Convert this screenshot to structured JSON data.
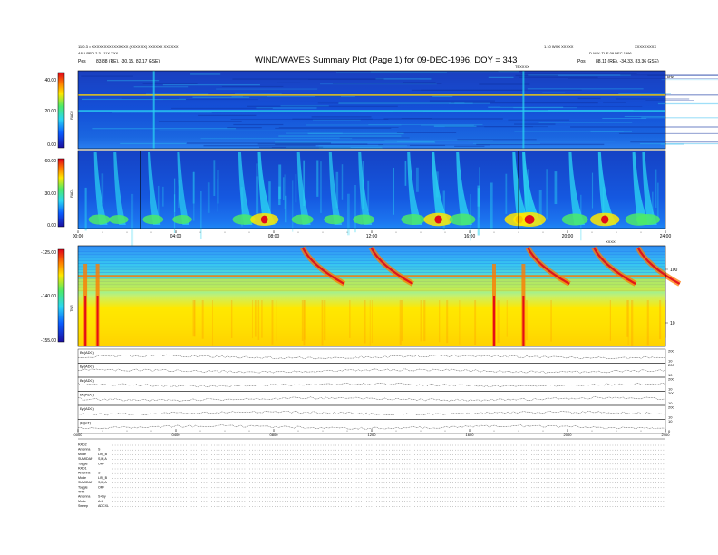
{
  "header": {
    "left_line1": "11 0.3 = XXXXXXXXXXXXXXX (XXXX XX) XXXXXX XXXXXX",
    "left_line2": "ASU PRO 2.3 - 11X XXX",
    "left_pos_label": "Pos",
    "left_pos_value": "83.88 (RE), -30.15, 82.17 GSE)",
    "title": "WIND/WAVES Summary Plot (Page 1) for 09-DEC-1996, DOY = 343",
    "right_line1_a": "1.10 WXX XXXXX",
    "right_line1_b": "XXXXXXXXX",
    "right_line2": "D-M-Y: TUE 09 DEC 1996",
    "right_pos_label": "Pos",
    "right_pos_value": "88.11 (RE), -34.33, 83.36 GSE)",
    "right_sub": "TEXXXX",
    "khz_label": "kHz"
  },
  "panels": {
    "rad2": {
      "label": "RAD2",
      "ticks": [
        "40.00",
        "20.00",
        "0.00"
      ]
    },
    "rad1": {
      "label": "RAD1",
      "ticks": [
        "60.00",
        "30.00",
        "0.00"
      ]
    },
    "tnr": {
      "label": "TNR",
      "ticks": [
        "-125.00",
        "-140.00",
        "-155.00"
      ],
      "right_ticks": [
        "100",
        "10"
      ]
    }
  },
  "time_axis": {
    "ticks": [
      "00:00",
      "04:00",
      "08:00",
      "12:00",
      "16:00",
      "20:00",
      "24:00"
    ],
    "ticks_small": [
      "0000",
      "0400",
      "0800",
      "1200",
      "1600",
      "2000",
      "2400"
    ],
    "right_label": "XXXX"
  },
  "traces": [
    {
      "label": "Bx(ADC)",
      "scale_top": "200",
      "scale_bot": "10"
    },
    {
      "label": "By(ADC)",
      "scale_top": "200",
      "scale_bot": "10"
    },
    {
      "label": "Bz(ADC)",
      "scale_top": "200",
      "scale_bot": "10"
    },
    {
      "label": "Ex(ADC)",
      "scale_top": "200",
      "scale_bot": "10"
    },
    {
      "label": "Ey(ADC)",
      "scale_top": "200",
      "scale_bot": "10"
    },
    {
      "label": "|B|(nT)",
      "scale_top": "10",
      "scale_bot": "0"
    }
  ],
  "status_rows": [
    "RAD2",
    "Antenna",
    "Mode",
    "SUMIDAP",
    "Toggle",
    "RAD1",
    "Antenna",
    "Mode",
    "SUMIDAP",
    "Toggle",
    "TNR",
    "Antenna",
    "Mode",
    "Sweep"
  ],
  "status_values": [
    "",
    "S",
    "LIN_B",
    "S,M,A",
    "OFF",
    "",
    "S",
    "LIN_B",
    "S,M,A",
    "OFF",
    "",
    "S+Sy",
    "A-B",
    "ADCXL"
  ],
  "colors": {
    "low": "#0a1f8f",
    "mid": "#2ad6f2",
    "high": "#ffe800",
    "peak": "#e0001a"
  },
  "chart_data": [
    {
      "type": "heatmap",
      "name": "RAD2",
      "x_range": [
        "00:00",
        "24:00"
      ],
      "ylim": [
        0,
        40
      ],
      "colorbar": {
        "min": 0.0,
        "mid": 20.0,
        "max": 40.0
      },
      "features": [
        {
          "kind": "narrowband-line",
          "y": 27.5,
          "x_start": 0,
          "x_end": 24
        },
        {
          "kind": "narrowband-line",
          "y": 19.5,
          "x_start": 0,
          "x_end": 24
        },
        {
          "kind": "burst",
          "x": 3.1
        },
        {
          "kind": "burst",
          "x": 18.2
        }
      ]
    },
    {
      "type": "heatmap",
      "name": "RAD1",
      "x_range": [
        "00:00",
        "24:00"
      ],
      "ylim": [
        0,
        60
      ],
      "colorbar": {
        "min": 0.0,
        "mid": 30.0,
        "max": 60.0
      },
      "bursts": [
        {
          "x": 0.8,
          "intensity": 0.5
        },
        {
          "x": 1.6,
          "intensity": 0.4
        },
        {
          "x": 3.0,
          "intensity": 0.45
        },
        {
          "x": 4.2,
          "intensity": 0.4
        },
        {
          "x": 6.7,
          "intensity": 0.55
        },
        {
          "x": 7.5,
          "intensity": 0.8
        },
        {
          "x": 9.1,
          "intensity": 0.5
        },
        {
          "x": 10.4,
          "intensity": 0.45
        },
        {
          "x": 11.6,
          "intensity": 0.5
        },
        {
          "x": 13.6,
          "intensity": 0.6
        },
        {
          "x": 14.6,
          "intensity": 0.85
        },
        {
          "x": 15.6,
          "intensity": 0.7
        },
        {
          "x": 17.9,
          "intensity": 0.85
        },
        {
          "x": 18.3,
          "intensity": 1.0
        },
        {
          "x": 20.2,
          "intensity": 0.7
        },
        {
          "x": 21.4,
          "intensity": 0.85
        },
        {
          "x": 22.8,
          "intensity": 0.75
        },
        {
          "x": 23.2,
          "intensity": 0.6
        }
      ]
    },
    {
      "type": "heatmap",
      "name": "TNR",
      "x_range": [
        "00:00",
        "24:00"
      ],
      "ylim": [
        -155,
        -125
      ],
      "colorbar": {
        "min": -155.0,
        "mid": -140.0,
        "max": -125.0
      },
      "features": [
        {
          "kind": "plasma-line",
          "level": 0.7
        },
        {
          "kind": "intense-vertical",
          "x": 0.3
        },
        {
          "kind": "intense-vertical",
          "x": 0.8
        },
        {
          "kind": "intense-vertical",
          "x": 17.0
        },
        {
          "kind": "intense-vertical",
          "x": 18.2
        },
        {
          "kind": "type-III",
          "x": 9.4
        },
        {
          "kind": "type-III",
          "x": 12.2
        },
        {
          "kind": "type-III",
          "x": 18.6
        },
        {
          "kind": "type-III",
          "x": 21.3
        },
        {
          "kind": "type-III",
          "x": 23.1
        }
      ]
    }
  ]
}
